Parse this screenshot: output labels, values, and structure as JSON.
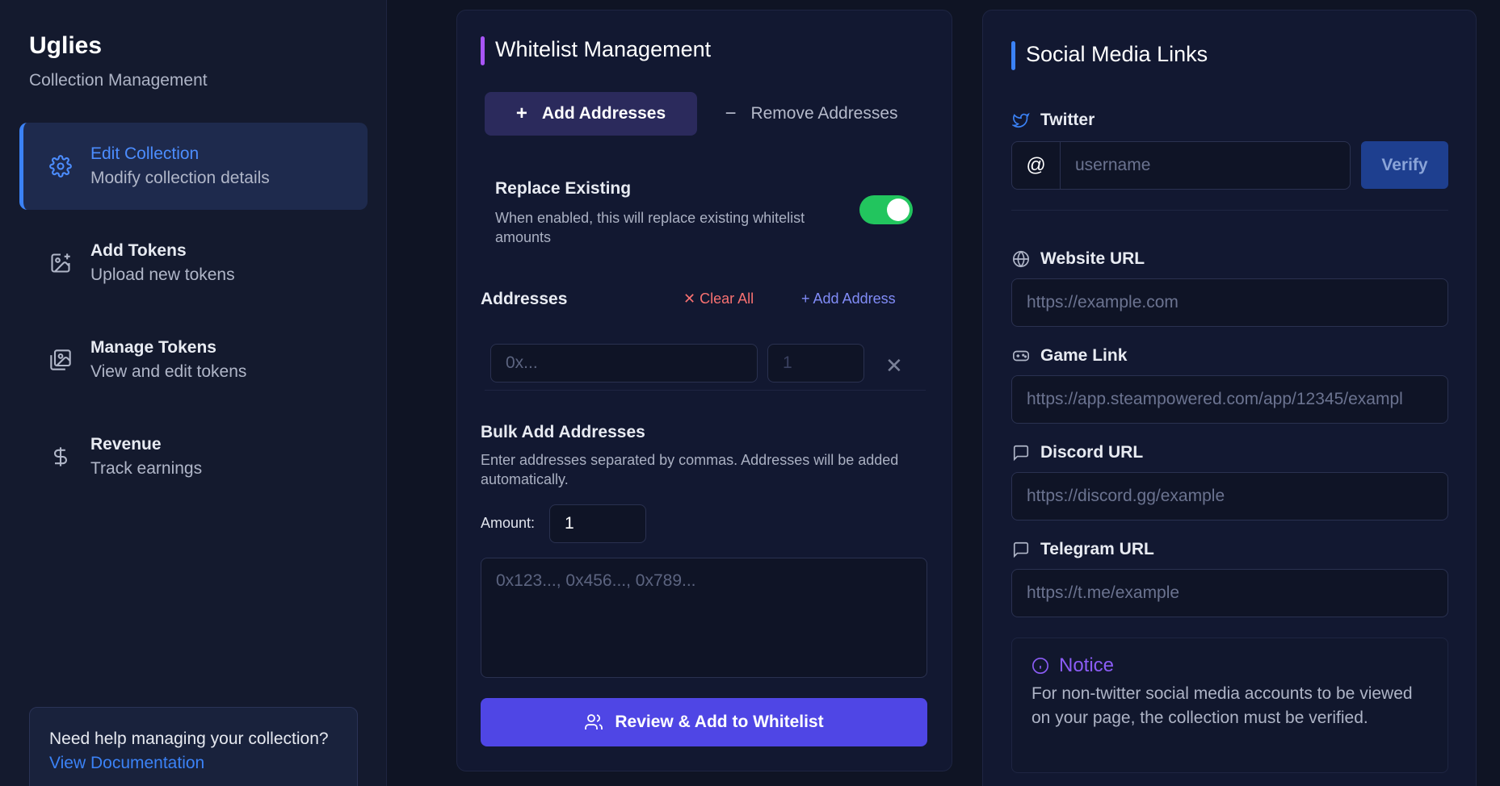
{
  "sidebar": {
    "title": "Uglies",
    "subtitle": "Collection Management",
    "items": [
      {
        "label": "Edit Collection",
        "desc": "Modify collection details",
        "icon": "gear-icon"
      },
      {
        "label": "Add Tokens",
        "desc": "Upload new tokens",
        "icon": "image-plus-icon"
      },
      {
        "label": "Manage Tokens",
        "desc": "View and edit tokens",
        "icon": "images-icon"
      },
      {
        "label": "Revenue",
        "desc": "Track earnings",
        "icon": "dollar-icon"
      }
    ],
    "help_text": "Need help managing your collection?",
    "help_link": "View Documentation"
  },
  "whitelist": {
    "title": "Whitelist Management",
    "tab_add": "Add Addresses",
    "tab_remove": "Remove Addresses",
    "replace_title": "Replace Existing",
    "replace_desc": "When enabled, this will replace existing whitelist amounts",
    "replace_enabled": true,
    "addresses_label": "Addresses",
    "clear_all": "Clear All",
    "add_address": "Add Address",
    "address_placeholder": "0x...",
    "amount_placeholder": "1",
    "bulk_title": "Bulk Add Addresses",
    "bulk_desc": "Enter addresses separated by commas. Addresses will be added automatically.",
    "amount_label": "Amount:",
    "amount_value": "1",
    "bulk_placeholder": "0x123..., 0x456..., 0x789...",
    "review_button": "Review & Add to Whitelist"
  },
  "social": {
    "title": "Social Media Links",
    "twitter_label": "Twitter",
    "at_symbol": "@",
    "twitter_placeholder": "username",
    "verify_button": "Verify",
    "website_label": "Website URL",
    "website_placeholder": "https://example.com",
    "game_label": "Game Link",
    "game_placeholder": "https://app.steampowered.com/app/12345/exampl",
    "discord_label": "Discord URL",
    "discord_placeholder": "https://discord.gg/example",
    "telegram_label": "Telegram URL",
    "telegram_placeholder": "https://t.me/example",
    "notice_title": "Notice",
    "notice_text": "For non-twitter social media accounts to be viewed on your page, the collection must be verified."
  },
  "colors": {
    "accent_blue": "#3b82f6",
    "accent_purple": "#a855f7",
    "primary_button": "#4f46e5",
    "toggle_on": "#22c55e",
    "danger": "#f87171"
  }
}
